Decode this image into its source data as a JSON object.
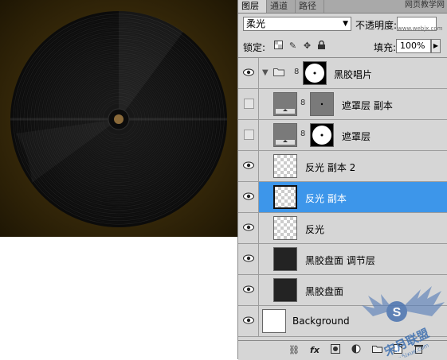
{
  "tabs": [
    {
      "label": "图层",
      "active": true
    },
    {
      "label": "通道",
      "active": false
    },
    {
      "label": "路径",
      "active": false
    }
  ],
  "watermark": {
    "title": "网页教学网",
    "url": "www.webjx.com",
    "logo_text": "宋月联盟",
    "logo_url": "www.5ixue.com"
  },
  "blend_mode": {
    "value": "柔光"
  },
  "opacity": {
    "label": "不透明度:"
  },
  "lock": {
    "label": "锁定:",
    "icons": [
      "lock-transparent-icon",
      "lock-brush-icon",
      "lock-move-icon",
      "lock-all-icon"
    ]
  },
  "fill": {
    "label": "填充:",
    "value": "100%"
  },
  "layers": [
    {
      "name": "黑胶唱片",
      "type": "group",
      "visible": true,
      "expanded": true
    },
    {
      "name": "遮罩层 副本",
      "type": "masked",
      "visible": false
    },
    {
      "name": "遮罩层",
      "type": "masked",
      "visible": false
    },
    {
      "name": "反光 副本 2",
      "type": "layer",
      "visible": true
    },
    {
      "name": "反光 副本",
      "type": "layer",
      "visible": true,
      "selected": true
    },
    {
      "name": "反光",
      "type": "layer",
      "visible": true
    },
    {
      "name": "黑胶盘面 调节层",
      "type": "layer",
      "visible": true
    },
    {
      "name": "黑胶盘面",
      "type": "layer",
      "visible": true
    },
    {
      "name": "Background",
      "type": "background",
      "visible": true
    }
  ],
  "footer_tools": [
    "link-icon",
    "fx-icon",
    "mask-icon",
    "adjustment-icon",
    "folder-icon",
    "new-layer-icon",
    "trash-icon"
  ],
  "colors": {
    "selected": "#3d96ea",
    "canvas_bg": "#3d2e0c",
    "record": "#151515",
    "label": "#8a6a3a"
  }
}
